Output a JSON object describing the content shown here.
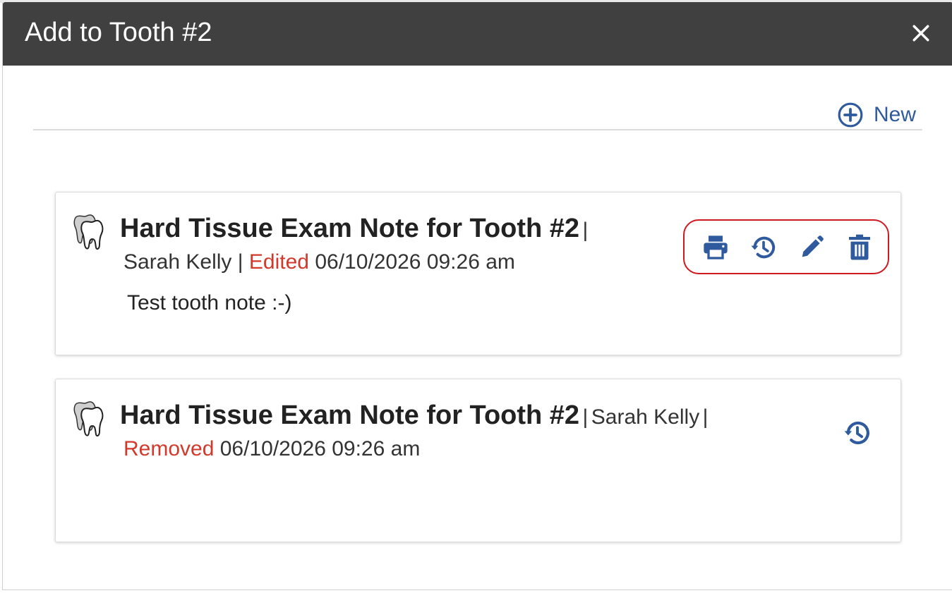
{
  "modal": {
    "title": "Add to Tooth #2",
    "close_icon": "close-icon"
  },
  "toolbar": {
    "new_label": "New",
    "new_icon": "plus-circle-icon"
  },
  "colors": {
    "header_bg": "#404040",
    "accent_blue": "#2f5a9e",
    "status_red": "#d2392b",
    "highlight_outline": "#d01820"
  },
  "notes": [
    {
      "title": "Hard Tissue Exam Note for Tooth #2",
      "separator": "|",
      "author": "Sarah Kelly",
      "status": "Edited",
      "timestamp": "06/10/2026 09:26 am",
      "body": "Test tooth note :-)",
      "icon": "tooth-icon",
      "actions": [
        "print-icon",
        "history-icon",
        "edit-icon",
        "delete-icon"
      ]
    },
    {
      "title": "Hard Tissue Exam Note for Tooth #2",
      "separator": "|",
      "author": "Sarah Kelly",
      "status": "Removed",
      "timestamp": "06/10/2026 09:26 am",
      "body": "",
      "icon": "tooth-icon",
      "actions": [
        "history-icon"
      ]
    }
  ]
}
